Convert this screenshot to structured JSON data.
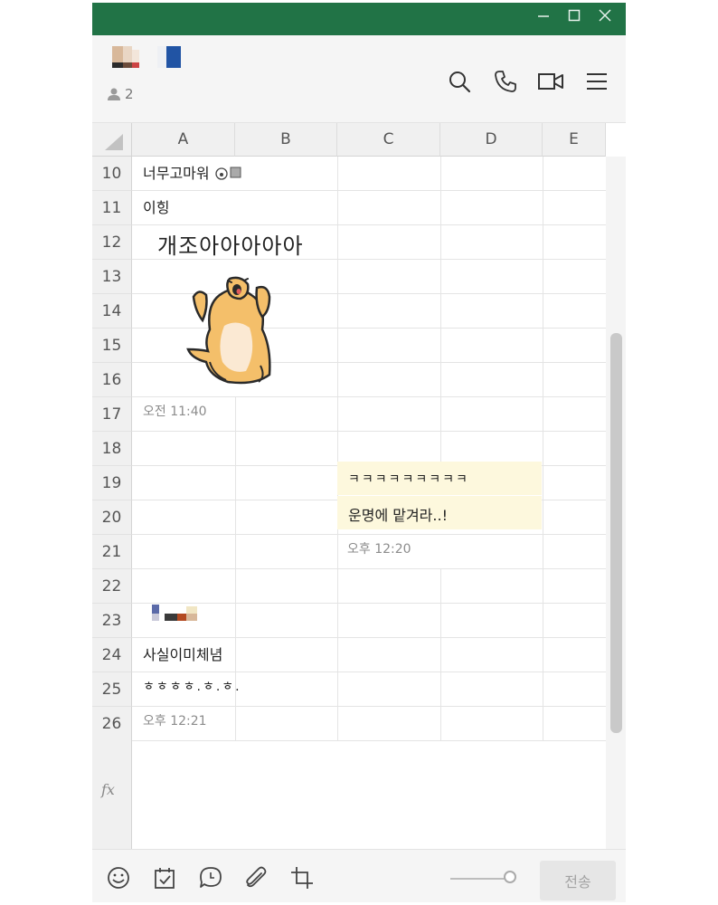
{
  "window": {
    "controls": [
      "minimize",
      "maximize",
      "close"
    ],
    "title_bar_color": "#217346"
  },
  "header": {
    "member_count": "2",
    "icons": [
      "search-icon",
      "phone-icon",
      "video-icon",
      "menu-icon"
    ]
  },
  "sheet": {
    "columns": [
      "A",
      "B",
      "C",
      "D",
      "E"
    ],
    "rows": [
      "10",
      "11",
      "12",
      "13",
      "14",
      "15",
      "16",
      "17",
      "18",
      "19",
      "20",
      "21",
      "22",
      "23",
      "24",
      "25",
      "26"
    ],
    "formula_label": "fx"
  },
  "messages": {
    "m1": "너무고마워",
    "m2": "이힝",
    "m3": "개조아아아아아",
    "sticker": "shiba-dog-sticker",
    "t1": "오전 11:40",
    "reply1": "ㅋㅋㅋㅋㅋㅋㅋㅋㅋ",
    "reply2": "운명에 맡겨라..!",
    "t2": "오후 12:20",
    "m4": "사실이미체념",
    "m5": "ㅎㅎㅎㅎ.ㅎ.ㅎ.",
    "t3": "오후 12:21"
  },
  "toolbar": {
    "icons": [
      "emoji-icon",
      "calendar-icon",
      "chat-bubble-icon",
      "paperclip-icon",
      "crop-icon"
    ],
    "send_label": "전송"
  },
  "colors": {
    "bubble": "#fdf8dd",
    "header_bg": "#f5f5f5"
  }
}
